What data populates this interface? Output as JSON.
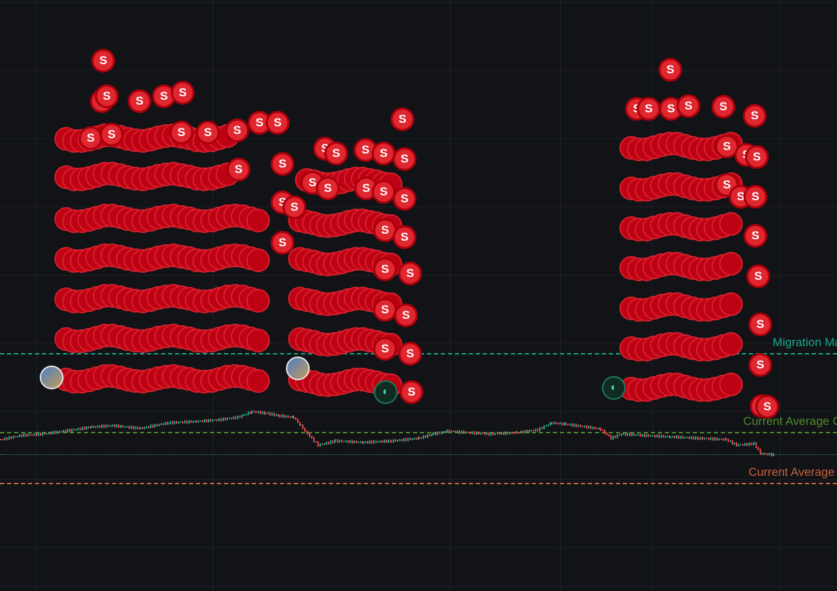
{
  "chart": {
    "levels": {
      "migration": {
        "label": "Migration Ma",
        "color": "#1aa589"
      },
      "avg_cost": {
        "label": "Current Average C",
        "color": "#4e8a2c"
      },
      "avg_other": {
        "label": "Current Average I",
        "color": "#c6623d"
      },
      "last_price_line_color": "#2e8f80"
    },
    "marker": {
      "glyph": "S",
      "type": "sell-marker",
      "fill_color": "#c00415",
      "border_color": "#e8323f"
    },
    "avatars": [
      {
        "name": "trader-avatar-1",
        "style": "photo"
      },
      {
        "name": "trader-avatar-2",
        "style": "photo"
      },
      {
        "name": "trader-avatar-3",
        "style": "green"
      },
      {
        "name": "trader-avatar-4",
        "style": "green"
      }
    ],
    "candle_colors": {
      "up": "#1aa589",
      "down": "#e0454d"
    }
  }
}
